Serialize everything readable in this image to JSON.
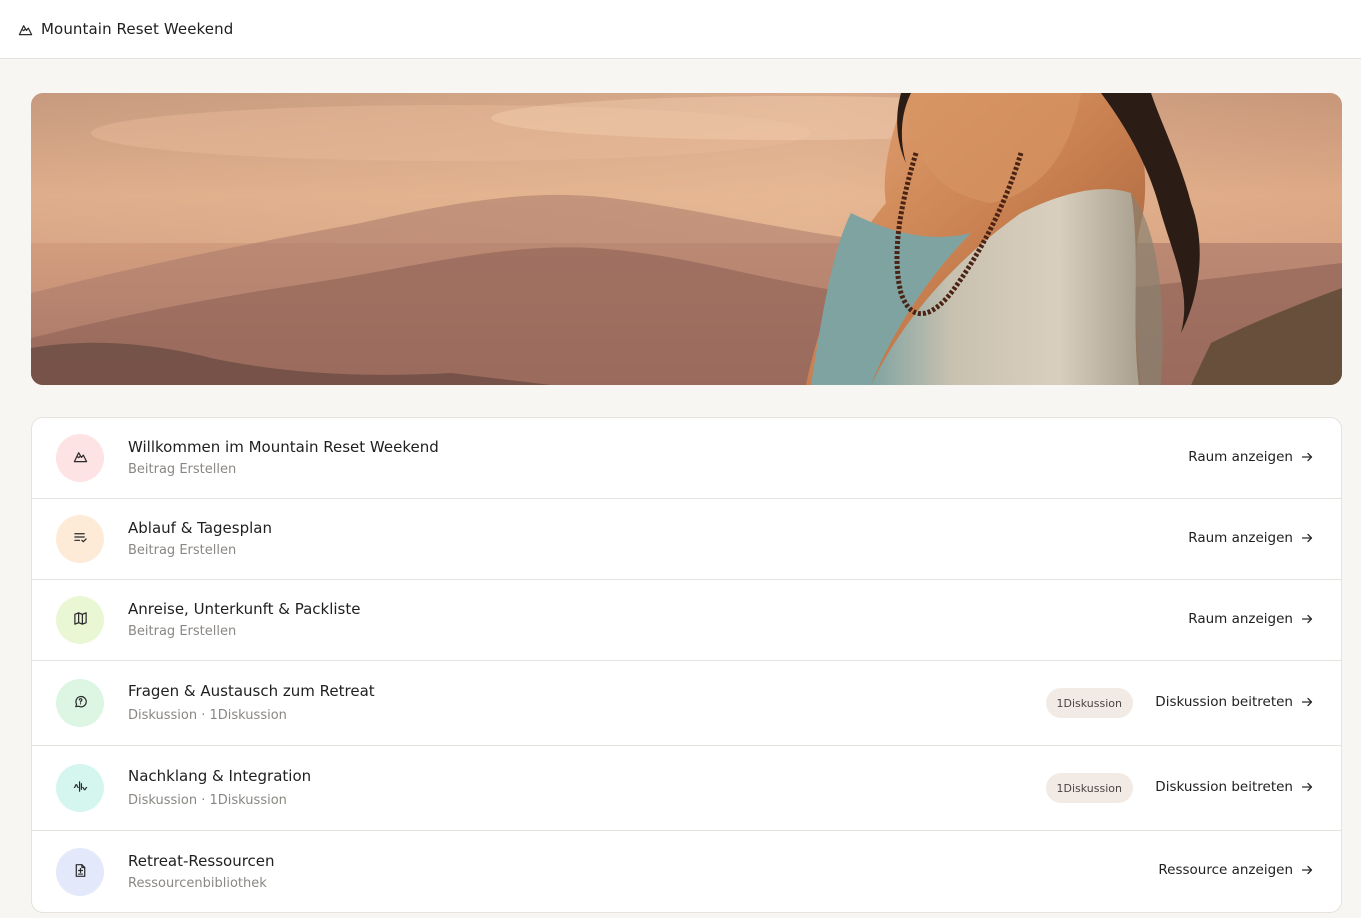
{
  "header": {
    "title": "Mountain Reset Weekend",
    "logo_icon": "mountain-icon"
  },
  "hero": {
    "image_description_icon": "hero-banner-image"
  },
  "spaces": [
    {
      "title": "Willkommen im Mountain Reset Weekend",
      "subtitle": "Beitrag Erstellen",
      "icon": "mountain-icon",
      "icon_bg": "#fde3e3",
      "action": "Raum anzeigen"
    },
    {
      "title": "Ablauf & Tagesplan",
      "subtitle": "Beitrag Erstellen",
      "icon": "list-check-icon",
      "icon_bg": "#fdebd8",
      "action": "Raum anzeigen"
    },
    {
      "title": "Anreise, Unterkunft & Packliste",
      "subtitle": "Beitrag Erstellen",
      "icon": "map-icon",
      "icon_bg": "#eaf7d4",
      "action": "Raum anzeigen"
    },
    {
      "title": "Fragen & Austausch zum Retreat",
      "subtitle": "Diskussion · 1Diskussion",
      "icon": "message-question-icon",
      "icon_bg": "#dcf6e3",
      "badge": "1Diskussion",
      "action": "Diskussion beitreten"
    },
    {
      "title": "Nachklang & Integration",
      "subtitle": "Diskussion · 1Diskussion",
      "icon": "audio-wave-icon",
      "icon_bg": "#d5f6ee",
      "badge": "1Diskussion",
      "action": "Diskussion beitreten"
    },
    {
      "title": "Retreat-Ressourcen",
      "subtitle": "Ressourcenbibliothek",
      "icon": "file-document-icon",
      "icon_bg": "#e3e8fb",
      "action": "Ressource anzeigen"
    }
  ]
}
